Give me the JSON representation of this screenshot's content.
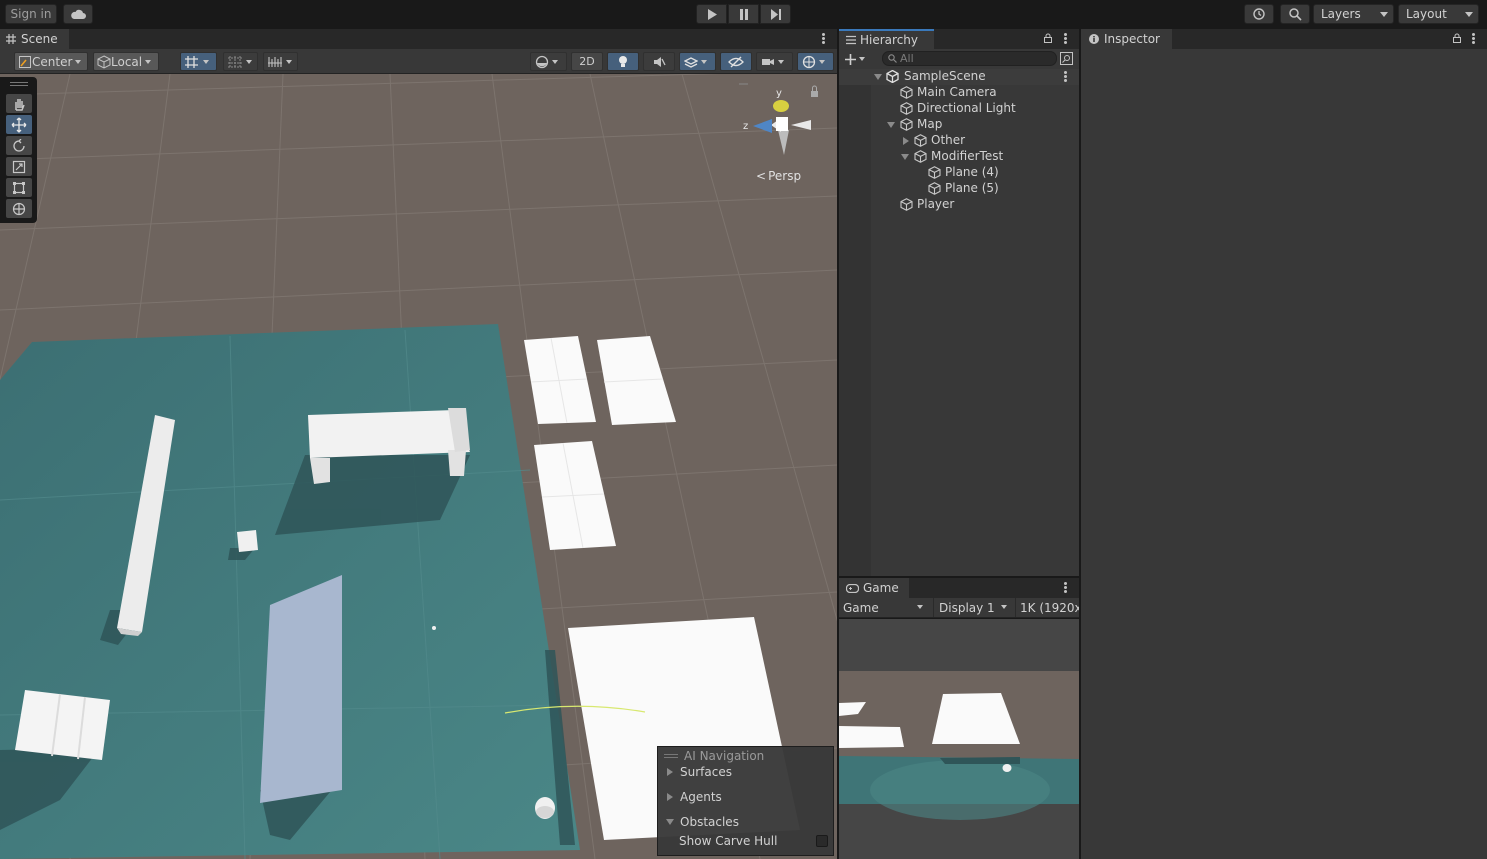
{
  "topbar": {
    "sign_in": "Sign in",
    "layers": "Layers",
    "layout": "Layout"
  },
  "scene": {
    "tab": "Scene",
    "pivot": "Center",
    "space": "Local",
    "mode_2d": "2D",
    "persp": "Persp",
    "gizmo_y": "y",
    "gizmo_z": "z"
  },
  "ai_navigation": {
    "title": "AI Navigation",
    "surfaces": "Surfaces",
    "agents": "Agents",
    "obstacles": "Obstacles",
    "show_carve_hull": "Show Carve Hull"
  },
  "hierarchy": {
    "tab": "Hierarchy",
    "search_placeholder": "All",
    "scene_name": "SampleScene",
    "items": [
      {
        "label": "Main Camera"
      },
      {
        "label": "Directional Light"
      },
      {
        "label": "Map"
      },
      {
        "label": "Other"
      },
      {
        "label": "ModifierTest"
      },
      {
        "label": "Plane (4)"
      },
      {
        "label": "Plane (5)"
      },
      {
        "label": "Player"
      }
    ]
  },
  "game": {
    "tab": "Game",
    "view": "Game",
    "display": "Display 1",
    "resolution": "1K (1920x1"
  },
  "inspector": {
    "tab": "Inspector"
  },
  "colors": {
    "accent_blue": "#46607c",
    "ground": "#6e645e",
    "plane_teal": "#3f7577"
  }
}
